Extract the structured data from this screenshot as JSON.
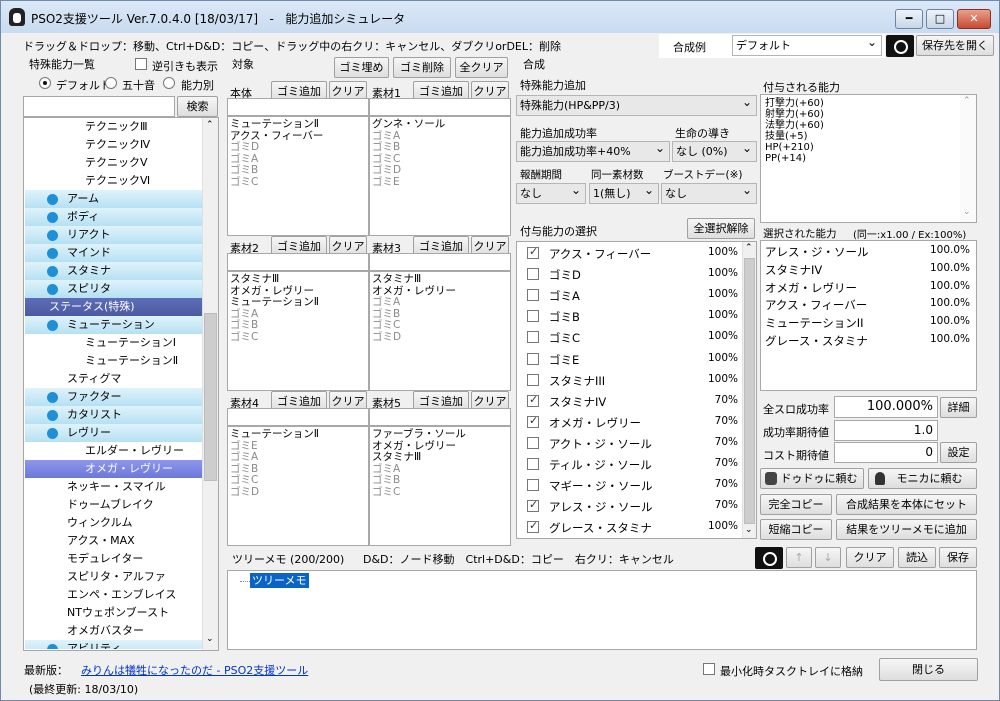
{
  "window": {
    "title": "PSO2支援ツール Ver.7.0.4.0 [18/03/17]   -   能力追加シミュレータ",
    "btn_min": "━",
    "btn_max": "□",
    "btn_close": "✕"
  },
  "hint": "ドラッグ＆ドロップ：移動、Ctrl+D&D：コピー、ドラッグ中の右クリ：キャンセル、ダブクリorDEL：削除",
  "synth_example": {
    "label": "合成例",
    "value": "デフォルト",
    "save_button": "保存先を開く"
  },
  "left": {
    "title": "特殊能力一覧",
    "reverse_label": "逆引きも表示",
    "radio": [
      "デフォルト",
      "五十音",
      "能力別"
    ],
    "search_button": "検索",
    "search_value": "",
    "tree": [
      {
        "t": "テクニックⅢ",
        "k": "leaf",
        "i": 60
      },
      {
        "t": "テクニックⅣ",
        "k": "leaf",
        "i": 60
      },
      {
        "t": "テクニックⅤ",
        "k": "leaf",
        "i": 60
      },
      {
        "t": "テクニックⅥ",
        "k": "leaf",
        "i": 60
      },
      {
        "t": "アーム",
        "k": "cat"
      },
      {
        "t": "ボディ",
        "k": "cat"
      },
      {
        "t": "リアクト",
        "k": "cat"
      },
      {
        "t": "マインド",
        "k": "cat"
      },
      {
        "t": "スタミナ",
        "k": "cat"
      },
      {
        "t": "スピリタ",
        "k": "cat"
      },
      {
        "t": "ステータス(特殊)",
        "k": "sec"
      },
      {
        "t": "ミューテーション",
        "k": "cat"
      },
      {
        "t": "ミューテーションⅠ",
        "k": "leaf",
        "i": 60
      },
      {
        "t": "ミューテーションⅡ",
        "k": "leaf",
        "i": 60
      },
      {
        "t": "スティグマ",
        "k": "leaf",
        "i": 42
      },
      {
        "t": "ファクター",
        "k": "cat"
      },
      {
        "t": "カタリスト",
        "k": "cat"
      },
      {
        "t": "レヴリー",
        "k": "cat"
      },
      {
        "t": "エルダー・レヴリー",
        "k": "leaf",
        "i": 60
      },
      {
        "t": "オメガ・レヴリー",
        "k": "sel",
        "i": 60
      },
      {
        "t": "ネッキー・スマイル",
        "k": "leaf",
        "i": 42
      },
      {
        "t": "ドゥームブレイク",
        "k": "leaf",
        "i": 42
      },
      {
        "t": "ウィンクルム",
        "k": "leaf",
        "i": 42
      },
      {
        "t": "アクス・MAX",
        "k": "leaf",
        "i": 42
      },
      {
        "t": "モデュレイター",
        "k": "leaf",
        "i": 42
      },
      {
        "t": "スピリタ・アルファ",
        "k": "leaf",
        "i": 42
      },
      {
        "t": "エンペ・エンブレイス",
        "k": "leaf",
        "i": 42
      },
      {
        "t": "NTウェポンブースト",
        "k": "leaf",
        "i": 42
      },
      {
        "t": "オメガバスター",
        "k": "leaf",
        "i": 42
      },
      {
        "t": "アビリティ",
        "k": "cat"
      }
    ]
  },
  "target": {
    "title": "対象",
    "fill_button": "ゴミ埋め",
    "del_button": "ゴミ削除",
    "clear_all": "全クリア",
    "add_label": "ゴミ追加",
    "clear_label": "クリア",
    "slots": [
      {
        "name": "本体",
        "items": [
          {
            "t": "ミューテーションⅡ"
          },
          {
            "t": "アクス・フィーバー"
          },
          {
            "t": "ゴミD",
            "g": 1
          },
          {
            "t": "ゴミA",
            "g": 1
          },
          {
            "t": "ゴミB",
            "g": 1
          },
          {
            "t": "ゴミC",
            "g": 1
          }
        ]
      },
      {
        "name": "素材1",
        "items": [
          {
            "t": "グンネ・ソール"
          },
          {
            "t": "ゴミA",
            "g": 1
          },
          {
            "t": "ゴミB",
            "g": 1
          },
          {
            "t": "ゴミC",
            "g": 1
          },
          {
            "t": "ゴミD",
            "g": 1
          },
          {
            "t": "ゴミE",
            "g": 1
          }
        ]
      },
      {
        "name": "素材2",
        "items": [
          {
            "t": "スタミナⅢ"
          },
          {
            "t": "オメガ・レヴリー"
          },
          {
            "t": "ミューテーションⅡ"
          },
          {
            "t": "ゴミA",
            "g": 1
          },
          {
            "t": "ゴミB",
            "g": 1
          },
          {
            "t": "ゴミC",
            "g": 1
          }
        ]
      },
      {
        "name": "素材3",
        "items": [
          {
            "t": "スタミナⅢ"
          },
          {
            "t": "オメガ・レヴリー"
          },
          {
            "t": "ゴミA",
            "g": 1
          },
          {
            "t": "ゴミB",
            "g": 1
          },
          {
            "t": "ゴミC",
            "g": 1
          },
          {
            "t": "ゴミD",
            "g": 1
          }
        ]
      },
      {
        "name": "素材4",
        "items": [
          {
            "t": "ミューテーションⅡ"
          },
          {
            "t": "ゴミE",
            "g": 1
          },
          {
            "t": "ゴミA",
            "g": 1
          },
          {
            "t": "ゴミB",
            "g": 1
          },
          {
            "t": "ゴミC",
            "g": 1
          },
          {
            "t": "ゴミD",
            "g": 1
          }
        ]
      },
      {
        "name": "素材5",
        "items": [
          {
            "t": "ファーブラ・ソール"
          },
          {
            "t": "オメガ・レヴリー"
          },
          {
            "t": "スタミナⅢ"
          },
          {
            "t": "ゴミA",
            "g": 1
          },
          {
            "t": "ゴミB",
            "g": 1
          },
          {
            "t": "ゴミC",
            "g": 1
          }
        ]
      }
    ]
  },
  "synthesis": {
    "title": "合成",
    "special_add_label": "特殊能力追加",
    "special_add_value": "特殊能力(HP&PP/3)",
    "rate_label": "能力追加成功率",
    "rate_value": "能力追加成功率+40%",
    "life_label": "生命の導き",
    "life_value": "なし (0%)",
    "reward_label": "報酬期間",
    "reward_value": "なし",
    "same_label": "同一素材数",
    "same_value": "1(無し)",
    "boost_label": "ブーストデー(※)",
    "boost_value": "なし",
    "granted_label": "付与される能力",
    "granted": [
      "打撃力(+60)",
      "射撃力(+60)",
      "法撃力(+60)",
      "技量(+5)",
      "HP(+210)",
      "PP(+14)"
    ],
    "select_label": "付与能力の選択",
    "deselect_all": "全選択解除",
    "grant_list": [
      {
        "n": "アクス・フィーバー",
        "p": "100%",
        "c": true
      },
      {
        "n": "ゴミD",
        "p": "100%",
        "c": false
      },
      {
        "n": "ゴミA",
        "p": "100%",
        "c": false
      },
      {
        "n": "ゴミB",
        "p": "100%",
        "c": false
      },
      {
        "n": "ゴミC",
        "p": "100%",
        "c": false
      },
      {
        "n": "ゴミE",
        "p": "100%",
        "c": false
      },
      {
        "n": "スタミナIII",
        "p": "100%",
        "c": false
      },
      {
        "n": "スタミナIV",
        "p": "70%",
        "c": true
      },
      {
        "n": "オメガ・レヴリー",
        "p": "70%",
        "c": true
      },
      {
        "n": "アクト・ジ・ソール",
        "p": "70%",
        "c": false
      },
      {
        "n": "ティル・ジ・ソール",
        "p": "70%",
        "c": false
      },
      {
        "n": "マギー・ジ・ソール",
        "p": "70%",
        "c": false
      },
      {
        "n": "アレス・ジ・ソール",
        "p": "70%",
        "c": true
      },
      {
        "n": "グレース・スタミナ",
        "p": "100%",
        "c": true
      }
    ],
    "selected_label": "選択された能力",
    "selected_info": "(同一:x1.00 / Ex:100%)",
    "selected": [
      {
        "n": "アレス・ジ・ソール",
        "p": "100.0%"
      },
      {
        "n": "スタミナIV",
        "p": "100.0%"
      },
      {
        "n": "オメガ・レヴリー",
        "p": "100.0%"
      },
      {
        "n": "アクス・フィーバー",
        "p": "100.0%"
      },
      {
        "n": "ミューテーションII",
        "p": "100.0%"
      },
      {
        "n": "グレース・スタミナ",
        "p": "100.0%"
      }
    ],
    "all_rate_label": "全スロ成功率",
    "all_rate_value": "100.000%",
    "detail_button": "詳細",
    "expect_label": "成功率期待値",
    "expect_value": "1.0",
    "cost_label": "コスト期待値",
    "cost_value": "0",
    "setting_button": "設定",
    "ask_doudou": "ドゥドゥに頼む",
    "ask_monica": "モニカに頼む",
    "full_copy": "完全コピー",
    "set_result": "合成結果を本体にセット",
    "short_copy": "短縮コピー",
    "add_tree": "結果をツリーメモに追加"
  },
  "memo": {
    "title": "ツリーメモ (200/200)",
    "hint": "D&D：ノード移動　Ctrl+D&D：コピー　右クリ：キャンセル",
    "up": "↑",
    "down": "↓",
    "clear": "クリア",
    "load": "読込",
    "save": "保存",
    "node": "ツリーメモ"
  },
  "footer": {
    "latest_label": "最新版：",
    "link": "みりんは犠牲になったのだ - PSO2支援ツール",
    "updated": "(最終更新: 18/03/10)",
    "tray_label": "最小化時タスクトレイに格納",
    "close": "閉じる"
  }
}
